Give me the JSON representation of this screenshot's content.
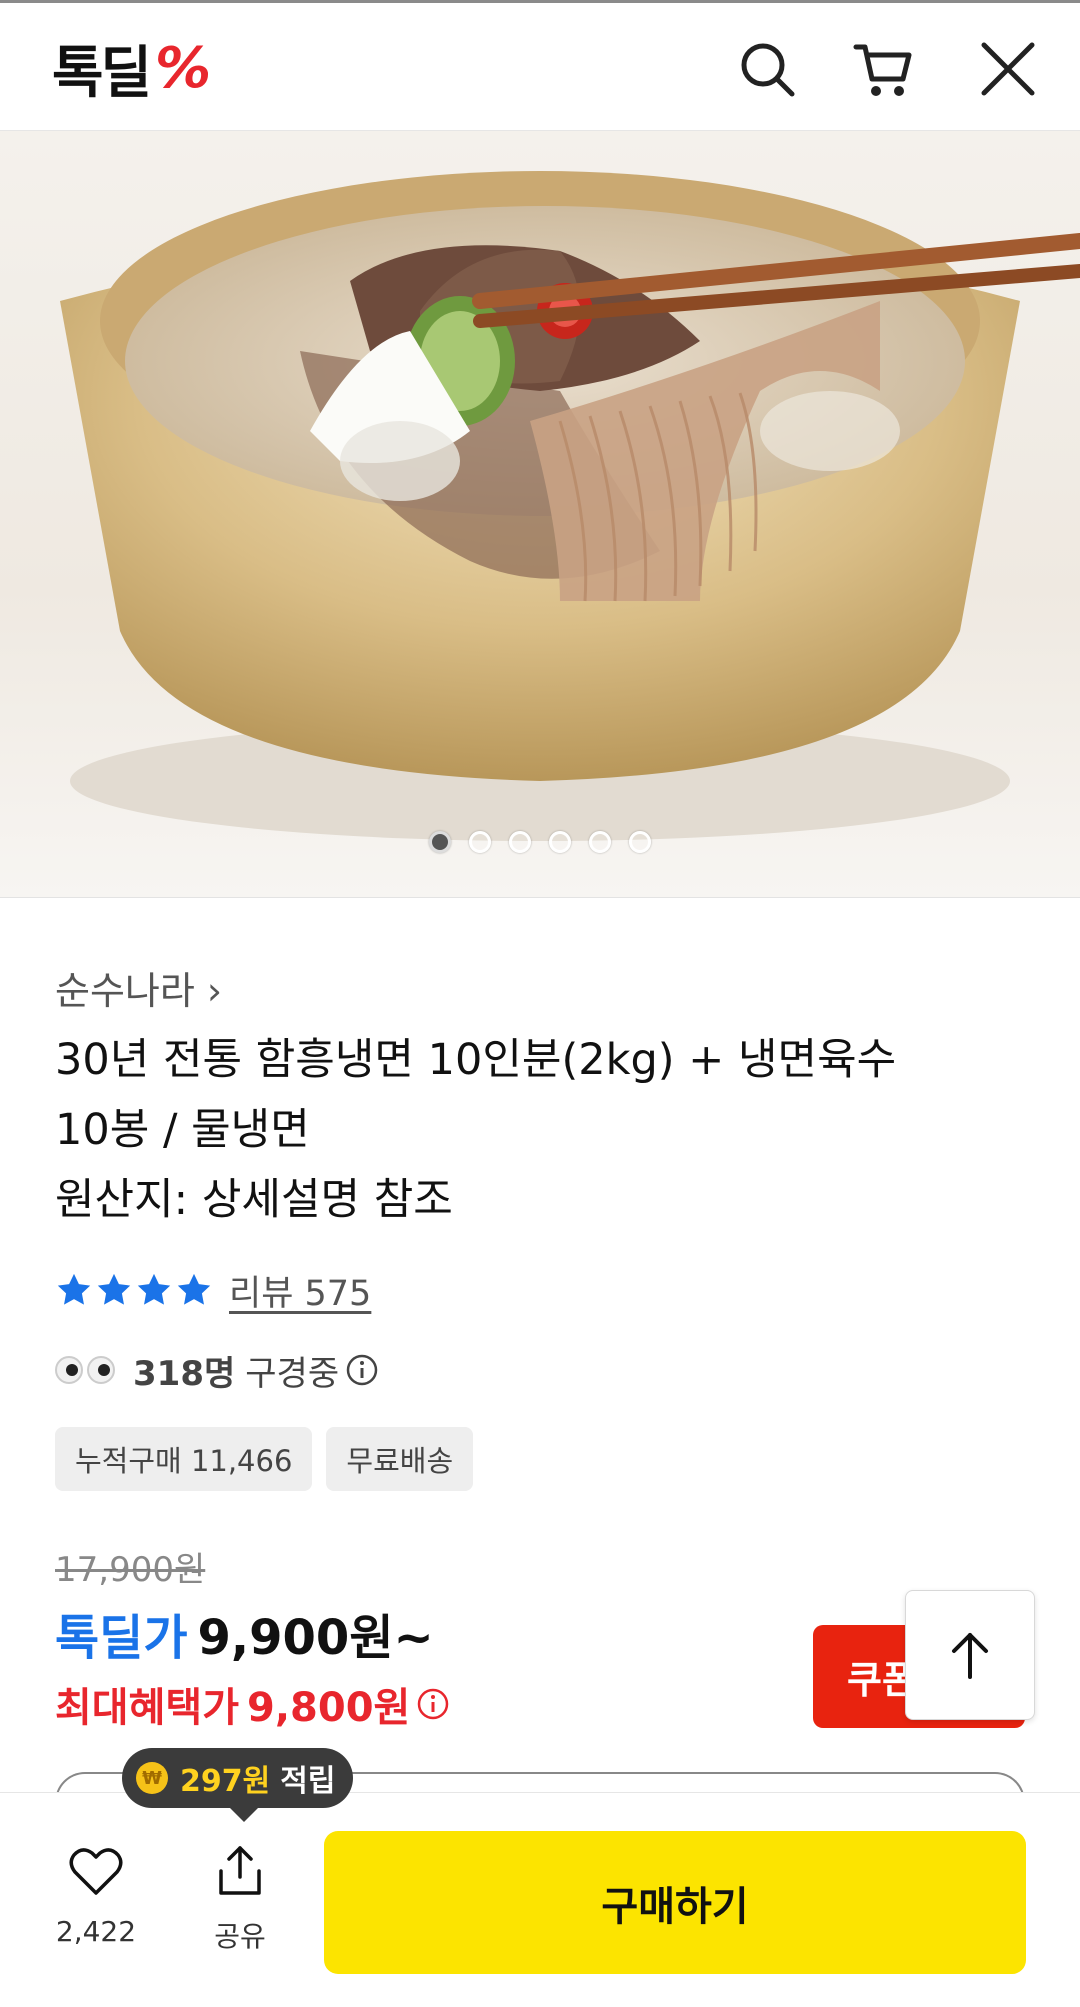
{
  "header": {
    "logo_text": "톡딜",
    "logo_mark": "%",
    "icons": [
      "search-icon",
      "cart-icon",
      "close-icon"
    ]
  },
  "hero": {
    "image_description_icon": "food-photo",
    "slide_count": 6,
    "active_slide": 1
  },
  "product": {
    "brand": "순수나라 ›",
    "title_lines": [
      "30년 전통 함흥냉면 10인분(2kg) + 냉면육수",
      "10봉 / 물냉면",
      "원산지: 상세설명 참조"
    ],
    "rating_stars": 4,
    "review_label": "리뷰 575",
    "viewers_count": "318명",
    "viewers_label": "구경중",
    "tags": [
      "누적구매 11,466",
      "무료배송"
    ],
    "original_price": "17,900원",
    "deal_label": "톡딜가",
    "deal_price": "9,900원~",
    "max_benefit_label": "최대혜택가",
    "max_benefit_price": "9,800원",
    "coupon_label": "쿠폰"
  },
  "bottom": {
    "points_amount": "297원",
    "points_label": "적립",
    "like_count": "2,422",
    "share_label": "공유",
    "buy_label": "구매하기"
  },
  "colors": {
    "brand_red": "#e8262d",
    "deal_blue": "#1a73e8",
    "star_blue": "#1a73e8",
    "buy_yellow": "#fce400",
    "coupon_red": "#e8230f"
  }
}
